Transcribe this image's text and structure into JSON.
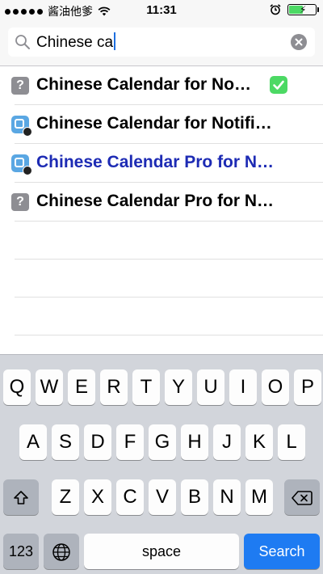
{
  "status_bar": {
    "carrier": "酱油他爹",
    "time": "11:31"
  },
  "search": {
    "value": "Chinese ca"
  },
  "results": [
    {
      "label": "Chinese Calendar for No…",
      "icon": "question-icon",
      "checked": true,
      "selected": false
    },
    {
      "label": "Chinese Calendar for Notifi…",
      "icon": "app-store-icon",
      "checked": false,
      "selected": false
    },
    {
      "label": "Chinese Calendar Pro for N…",
      "icon": "app-store-icon",
      "checked": false,
      "selected": true
    },
    {
      "label": "Chinese Calendar Pro for N…",
      "icon": "question-icon",
      "checked": false,
      "selected": false
    }
  ],
  "keyboard": {
    "row1": [
      "Q",
      "W",
      "E",
      "R",
      "T",
      "Y",
      "U",
      "I",
      "O",
      "P"
    ],
    "row2": [
      "A",
      "S",
      "D",
      "F",
      "G",
      "H",
      "J",
      "K",
      "L"
    ],
    "row3": [
      "Z",
      "X",
      "C",
      "V",
      "B",
      "N",
      "M"
    ],
    "numbers_label": "123",
    "space_label": "space",
    "search_label": "Search"
  },
  "colors": {
    "selected_text": "#1d2bb4",
    "check_green": "#4cd964",
    "search_key_blue": "#1e7bf2"
  }
}
